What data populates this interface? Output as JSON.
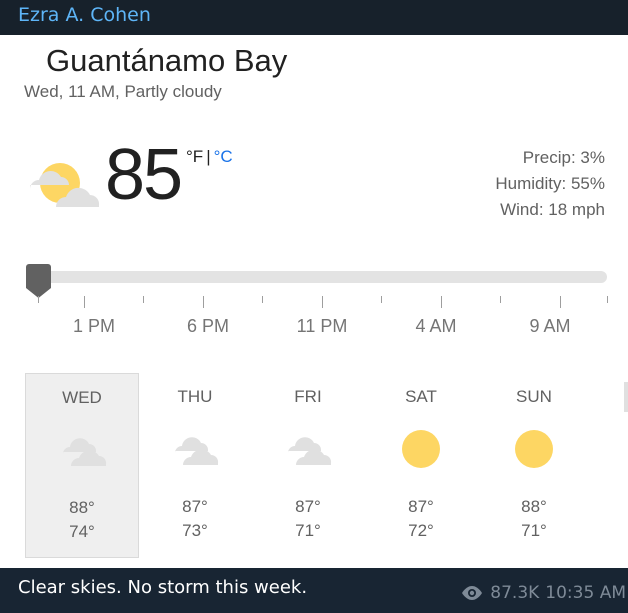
{
  "message": {
    "sender": "Ezra A. Cohen",
    "caption": "Clear skies. No storm this week.",
    "views": "87.3K",
    "time": "10:35 AM"
  },
  "weather": {
    "location": "Guantánamo Bay",
    "subtitle": "Wed, 11 AM, Partly cloudy",
    "current_icon": "partly-cloudy-icon",
    "temperature": "85",
    "unit_f": "°F",
    "unit_sep": "|",
    "unit_c": "°C",
    "precip": "Precip: 3%",
    "humidity": "Humidity: 55%",
    "wind": "Wind: 18 mph",
    "timeline_labels": [
      "1 PM",
      "6 PM",
      "11 PM",
      "4 AM",
      "9 AM"
    ],
    "slider_position": 0,
    "days": [
      {
        "name": "WED",
        "icon": "cloudy-icon",
        "high": "88°",
        "low": "74°",
        "selected": true
      },
      {
        "name": "THU",
        "icon": "cloudy-icon",
        "high": "87°",
        "low": "73°",
        "selected": false
      },
      {
        "name": "FRI",
        "icon": "cloudy-icon",
        "high": "87°",
        "low": "71°",
        "selected": false
      },
      {
        "name": "SAT",
        "icon": "sunny-icon",
        "high": "87°",
        "low": "72°",
        "selected": false
      },
      {
        "name": "SUN",
        "icon": "sunny-icon",
        "high": "88°",
        "low": "71°",
        "selected": false
      }
    ]
  },
  "colors": {
    "chat_bg": "#17212b",
    "sender": "#5eb5f7",
    "celsius_link": "#1a73e8",
    "sun": "#fdd663",
    "cloud": "#e0e0e0"
  }
}
